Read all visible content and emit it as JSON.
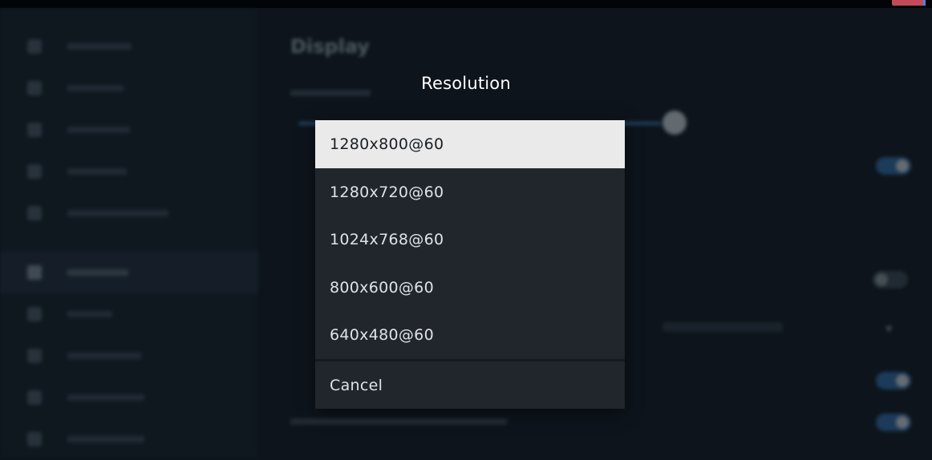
{
  "dialog": {
    "title": "Resolution",
    "options": [
      {
        "label": "1280x800@60",
        "selected": true
      },
      {
        "label": "1280x720@60",
        "selected": false
      },
      {
        "label": "1024x768@60",
        "selected": false
      },
      {
        "label": "800x600@60",
        "selected": false
      },
      {
        "label": "640x480@60",
        "selected": false
      }
    ],
    "cancel_label": "Cancel"
  },
  "background": {
    "page_title": "Display",
    "brightness_level": 0.96,
    "toggles": [
      true,
      false,
      true,
      true
    ]
  },
  "colors": {
    "selected_bg": "#eaeaea",
    "menu_bg": "#21262c",
    "accent": "#2f6aa8"
  }
}
